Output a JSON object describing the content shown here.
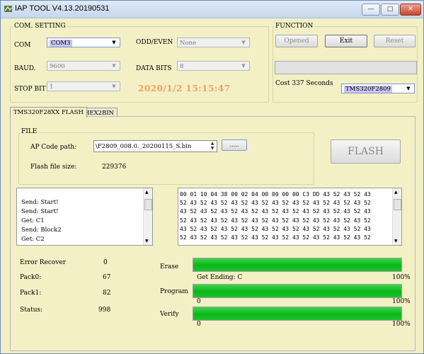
{
  "window": {
    "title": "IAP TOOL V4.13.20190531"
  },
  "com_setting": {
    "group_label": "COM. SETTING",
    "com_label": "COM",
    "com_value": "COM3",
    "baud_label": "BAUD.",
    "baud_value": "9600",
    "stop_bit_label": "STOP BIT",
    "stop_bit_value": "1",
    "odd_even_label": "ODD/EVEN",
    "odd_even_value": "None",
    "data_bits_label": "DATA BITS",
    "data_bits_value": "8",
    "datetime": "2020/1/2 15:15:47"
  },
  "function": {
    "group_label": "FUNCTION",
    "opened_label": "Opened",
    "exit_label": "Exit",
    "reset_label": "Reset",
    "cost_text": "Cost 337 Seconds",
    "chip_value": "TMS320F2809"
  },
  "tabs": [
    {
      "label": "TMS320F28XX FLASH"
    },
    {
      "label": "HEX2BIN"
    }
  ],
  "file": {
    "group_label": "FILE",
    "ap_code_label": "AP Code path:",
    "ap_code_value": "\\F2809_008.0._20200115_S.bin",
    "browse_label": ".....",
    "flash_size_label": "Flash file size:",
    "flash_size_value": "229376",
    "flash_button": "FLASH"
  },
  "log": [
    "Send: Start!",
    "Send: Start!",
    "Get: C1",
    "Send: Block2",
    "Get: C2"
  ],
  "hex_lines": [
    "00 01 10 04 38 00 02 04 00 00 00 00 C3 DD 43 52 43 52 43",
    "52 43 52 43 52 43 52 43 52 43 52 43 52 43 52 43 52 43 52",
    "43 52 43 52 43 52 43 52 43 52 43 52 43 52 43 52 43 52 43",
    "52 43 52 43 52 43 52 43 52 43 52 43 52 43 52 43 52 43 52",
    "43 52 43 52 43 52 43 52 43 52 43 52 43 52 43 52 43 52 43",
    "52 43 52 43 52 43 52 43 52 43 52 43 52 43 52 43 52 43 52"
  ],
  "stats": {
    "error_recover_label": "Error Recover",
    "error_recover_value": "0",
    "pack0_label": "Pack0:",
    "pack0_value": "67",
    "pack1_label": "Pack1:",
    "pack1_value": "82",
    "status_label": "Status:",
    "status_value": "998"
  },
  "progress": {
    "erase_label": "Erase",
    "erase_note": "Get Ending:  C",
    "erase_pct": "100%",
    "erase_fraction": 1.0,
    "program_label": "Program",
    "program_start": "0",
    "program_pct": "100%",
    "program_fraction": 1.0,
    "verify_label": "Verify",
    "verify_start": "0",
    "verify_pct": "100%",
    "verify_fraction": 1.0
  },
  "colors": {
    "background": "#f3f0c6",
    "progress_green": "#07b818",
    "datetime_orange": "#f0a060",
    "selection": "#c9c4f4"
  }
}
